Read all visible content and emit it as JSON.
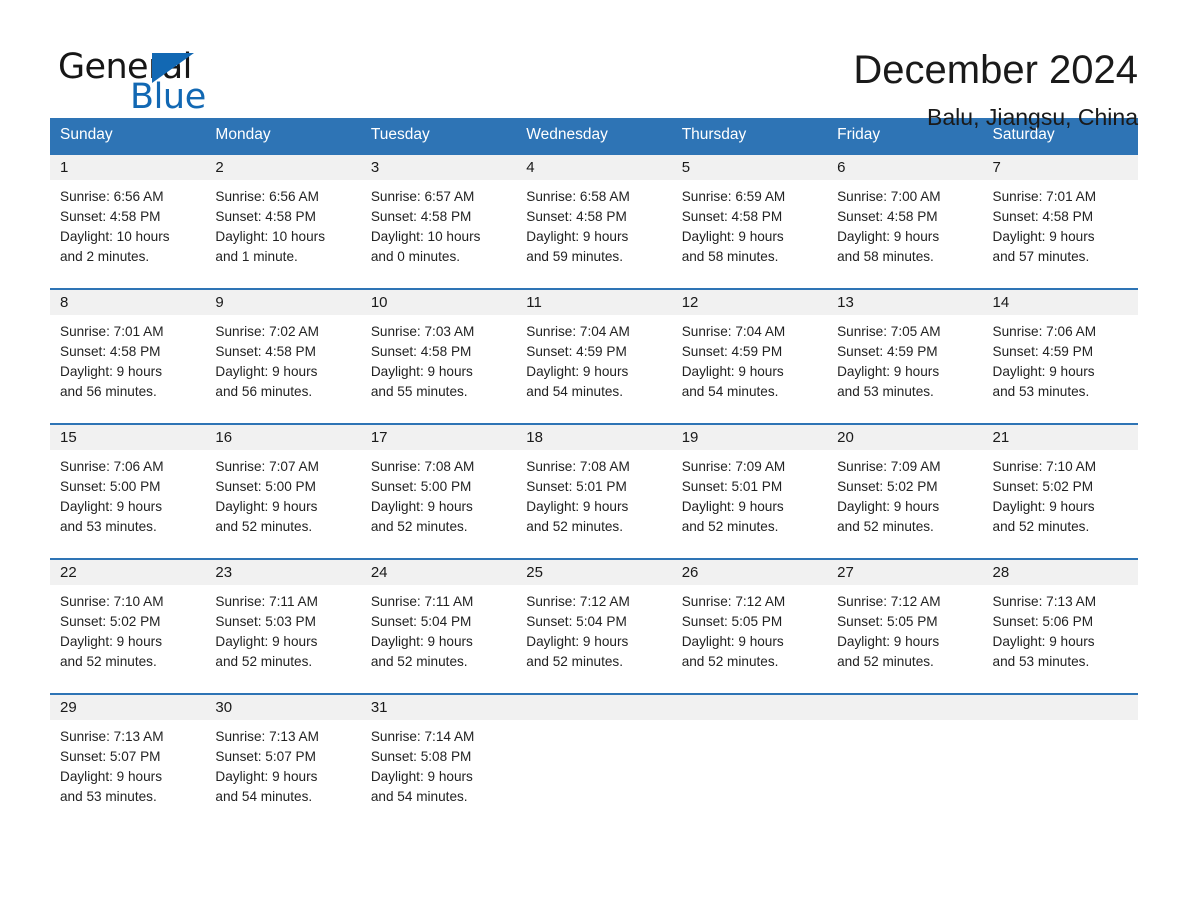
{
  "logo": {
    "word_dark": "General",
    "word_blue": "Blue",
    "triangle_icon": "blue-triangle-icon"
  },
  "header": {
    "title": "December 2024",
    "subtitle": "Balu, Jiangsu, China"
  },
  "colors": {
    "header_blue": "#2e74b5",
    "brand_blue": "#1268b3",
    "day_band_gray": "#f1f1f1",
    "text": "#1a1a1a"
  },
  "labels": {
    "sunrise_prefix": "Sunrise:",
    "sunset_prefix": "Sunset:",
    "daylight_prefix": "Daylight:"
  },
  "weekdays": [
    "Sunday",
    "Monday",
    "Tuesday",
    "Wednesday",
    "Thursday",
    "Friday",
    "Saturday"
  ],
  "weeks": [
    [
      {
        "day": "1",
        "sunrise": "Sunrise: 6:56 AM",
        "sunset": "Sunset: 4:58 PM",
        "daylight_line1": "Daylight: 10 hours",
        "daylight_line2": "and 2 minutes."
      },
      {
        "day": "2",
        "sunrise": "Sunrise: 6:56 AM",
        "sunset": "Sunset: 4:58 PM",
        "daylight_line1": "Daylight: 10 hours",
        "daylight_line2": "and 1 minute."
      },
      {
        "day": "3",
        "sunrise": "Sunrise: 6:57 AM",
        "sunset": "Sunset: 4:58 PM",
        "daylight_line1": "Daylight: 10 hours",
        "daylight_line2": "and 0 minutes."
      },
      {
        "day": "4",
        "sunrise": "Sunrise: 6:58 AM",
        "sunset": "Sunset: 4:58 PM",
        "daylight_line1": "Daylight: 9 hours",
        "daylight_line2": "and 59 minutes."
      },
      {
        "day": "5",
        "sunrise": "Sunrise: 6:59 AM",
        "sunset": "Sunset: 4:58 PM",
        "daylight_line1": "Daylight: 9 hours",
        "daylight_line2": "and 58 minutes."
      },
      {
        "day": "6",
        "sunrise": "Sunrise: 7:00 AM",
        "sunset": "Sunset: 4:58 PM",
        "daylight_line1": "Daylight: 9 hours",
        "daylight_line2": "and 58 minutes."
      },
      {
        "day": "7",
        "sunrise": "Sunrise: 7:01 AM",
        "sunset": "Sunset: 4:58 PM",
        "daylight_line1": "Daylight: 9 hours",
        "daylight_line2": "and 57 minutes."
      }
    ],
    [
      {
        "day": "8",
        "sunrise": "Sunrise: 7:01 AM",
        "sunset": "Sunset: 4:58 PM",
        "daylight_line1": "Daylight: 9 hours",
        "daylight_line2": "and 56 minutes."
      },
      {
        "day": "9",
        "sunrise": "Sunrise: 7:02 AM",
        "sunset": "Sunset: 4:58 PM",
        "daylight_line1": "Daylight: 9 hours",
        "daylight_line2": "and 56 minutes."
      },
      {
        "day": "10",
        "sunrise": "Sunrise: 7:03 AM",
        "sunset": "Sunset: 4:58 PM",
        "daylight_line1": "Daylight: 9 hours",
        "daylight_line2": "and 55 minutes."
      },
      {
        "day": "11",
        "sunrise": "Sunrise: 7:04 AM",
        "sunset": "Sunset: 4:59 PM",
        "daylight_line1": "Daylight: 9 hours",
        "daylight_line2": "and 54 minutes."
      },
      {
        "day": "12",
        "sunrise": "Sunrise: 7:04 AM",
        "sunset": "Sunset: 4:59 PM",
        "daylight_line1": "Daylight: 9 hours",
        "daylight_line2": "and 54 minutes."
      },
      {
        "day": "13",
        "sunrise": "Sunrise: 7:05 AM",
        "sunset": "Sunset: 4:59 PM",
        "daylight_line1": "Daylight: 9 hours",
        "daylight_line2": "and 53 minutes."
      },
      {
        "day": "14",
        "sunrise": "Sunrise: 7:06 AM",
        "sunset": "Sunset: 4:59 PM",
        "daylight_line1": "Daylight: 9 hours",
        "daylight_line2": "and 53 minutes."
      }
    ],
    [
      {
        "day": "15",
        "sunrise": "Sunrise: 7:06 AM",
        "sunset": "Sunset: 5:00 PM",
        "daylight_line1": "Daylight: 9 hours",
        "daylight_line2": "and 53 minutes."
      },
      {
        "day": "16",
        "sunrise": "Sunrise: 7:07 AM",
        "sunset": "Sunset: 5:00 PM",
        "daylight_line1": "Daylight: 9 hours",
        "daylight_line2": "and 52 minutes."
      },
      {
        "day": "17",
        "sunrise": "Sunrise: 7:08 AM",
        "sunset": "Sunset: 5:00 PM",
        "daylight_line1": "Daylight: 9 hours",
        "daylight_line2": "and 52 minutes."
      },
      {
        "day": "18",
        "sunrise": "Sunrise: 7:08 AM",
        "sunset": "Sunset: 5:01 PM",
        "daylight_line1": "Daylight: 9 hours",
        "daylight_line2": "and 52 minutes."
      },
      {
        "day": "19",
        "sunrise": "Sunrise: 7:09 AM",
        "sunset": "Sunset: 5:01 PM",
        "daylight_line1": "Daylight: 9 hours",
        "daylight_line2": "and 52 minutes."
      },
      {
        "day": "20",
        "sunrise": "Sunrise: 7:09 AM",
        "sunset": "Sunset: 5:02 PM",
        "daylight_line1": "Daylight: 9 hours",
        "daylight_line2": "and 52 minutes."
      },
      {
        "day": "21",
        "sunrise": "Sunrise: 7:10 AM",
        "sunset": "Sunset: 5:02 PM",
        "daylight_line1": "Daylight: 9 hours",
        "daylight_line2": "and 52 minutes."
      }
    ],
    [
      {
        "day": "22",
        "sunrise": "Sunrise: 7:10 AM",
        "sunset": "Sunset: 5:02 PM",
        "daylight_line1": "Daylight: 9 hours",
        "daylight_line2": "and 52 minutes."
      },
      {
        "day": "23",
        "sunrise": "Sunrise: 7:11 AM",
        "sunset": "Sunset: 5:03 PM",
        "daylight_line1": "Daylight: 9 hours",
        "daylight_line2": "and 52 minutes."
      },
      {
        "day": "24",
        "sunrise": "Sunrise: 7:11 AM",
        "sunset": "Sunset: 5:04 PM",
        "daylight_line1": "Daylight: 9 hours",
        "daylight_line2": "and 52 minutes."
      },
      {
        "day": "25",
        "sunrise": "Sunrise: 7:12 AM",
        "sunset": "Sunset: 5:04 PM",
        "daylight_line1": "Daylight: 9 hours",
        "daylight_line2": "and 52 minutes."
      },
      {
        "day": "26",
        "sunrise": "Sunrise: 7:12 AM",
        "sunset": "Sunset: 5:05 PM",
        "daylight_line1": "Daylight: 9 hours",
        "daylight_line2": "and 52 minutes."
      },
      {
        "day": "27",
        "sunrise": "Sunrise: 7:12 AM",
        "sunset": "Sunset: 5:05 PM",
        "daylight_line1": "Daylight: 9 hours",
        "daylight_line2": "and 52 minutes."
      },
      {
        "day": "28",
        "sunrise": "Sunrise: 7:13 AM",
        "sunset": "Sunset: 5:06 PM",
        "daylight_line1": "Daylight: 9 hours",
        "daylight_line2": "and 53 minutes."
      }
    ],
    [
      {
        "day": "29",
        "sunrise": "Sunrise: 7:13 AM",
        "sunset": "Sunset: 5:07 PM",
        "daylight_line1": "Daylight: 9 hours",
        "daylight_line2": "and 53 minutes."
      },
      {
        "day": "30",
        "sunrise": "Sunrise: 7:13 AM",
        "sunset": "Sunset: 5:07 PM",
        "daylight_line1": "Daylight: 9 hours",
        "daylight_line2": "and 54 minutes."
      },
      {
        "day": "31",
        "sunrise": "Sunrise: 7:14 AM",
        "sunset": "Sunset: 5:08 PM",
        "daylight_line1": "Daylight: 9 hours",
        "daylight_line2": "and 54 minutes."
      },
      {
        "day": "",
        "sunrise": "",
        "sunset": "",
        "daylight_line1": "",
        "daylight_line2": ""
      },
      {
        "day": "",
        "sunrise": "",
        "sunset": "",
        "daylight_line1": "",
        "daylight_line2": ""
      },
      {
        "day": "",
        "sunrise": "",
        "sunset": "",
        "daylight_line1": "",
        "daylight_line2": ""
      },
      {
        "day": "",
        "sunrise": "",
        "sunset": "",
        "daylight_line1": "",
        "daylight_line2": ""
      }
    ]
  ]
}
